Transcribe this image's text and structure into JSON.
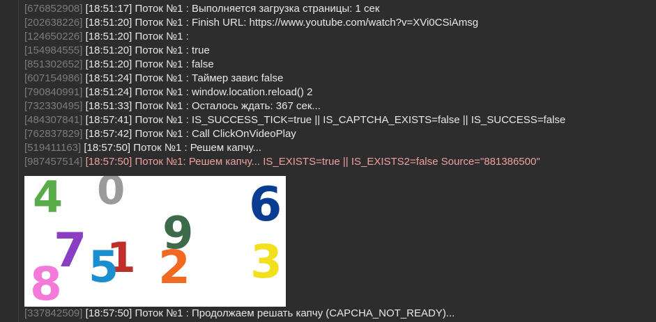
{
  "log": {
    "lines_top": [
      {
        "id": "[676852908]",
        "time": "[18:51:17]",
        "text": "Поток №1 : Выполняется загрузка страницы: 1 сек"
      },
      {
        "id": "[202638226]",
        "time": "[18:51:20]",
        "text": "Поток №1 : Finish URL: https://www.youtube.com/watch?v=XVi0CSiAmsg"
      },
      {
        "id": "[124650226]",
        "time": "[18:51:20]",
        "text": "Поток №1 :"
      },
      {
        "id": "[154984555]",
        "time": "[18:51:20]",
        "text": "Поток №1 : true"
      },
      {
        "id": "[851302652]",
        "time": "[18:51:20]",
        "text": "Поток №1 : false"
      },
      {
        "id": "[607154986]",
        "time": "[18:51:24]",
        "text": "Поток №1 : Таймер завис false"
      },
      {
        "id": "[790840991]",
        "time": "[18:51:24]",
        "text": "Поток №1 : window.location.reload() 2"
      },
      {
        "id": "[732330495]",
        "time": "[18:51:33]",
        "text": "Поток №1 : Осталось ждать: 367 сек..."
      },
      {
        "id": "[484307841]",
        "time": "[18:57:41]",
        "text": "Поток №1 : IS_SUCCESS_TICK=true || IS_CAPTCHA_EXISTS=false || IS_SUCCESS=false"
      },
      {
        "id": "[762837829]",
        "time": "[18:57:42]",
        "text": "Поток №1 : Call ClickOnVideoPlay"
      },
      {
        "id": "[519411163]",
        "time": "[18:57:50]",
        "text": "Поток №1 : Решем капчу..."
      },
      {
        "id": "[987457514]",
        "time": "[18:57:50]",
        "text": "Поток №1: Решем капчу... IS_EXISTS=true || IS_EXISTS2=false Source=\"881386500\"",
        "highlight": true
      }
    ],
    "line_bottom": {
      "id": "[337842509]",
      "time": "[18:57:50]",
      "text": "Поток №1 : Продолжаем решать капчу (CAPCHA_NOT_READY)..."
    }
  },
  "captcha": {
    "digits": [
      {
        "char": "4",
        "color": "#5aab4a"
      },
      {
        "char": "0",
        "color": "#9a9a9a"
      },
      {
        "char": "6",
        "color": "#0a3d91"
      },
      {
        "char": "9",
        "color": "#3d6a4a"
      },
      {
        "char": "7",
        "color": "#8a3fc2"
      },
      {
        "char": "5",
        "color": "#1a8fd0"
      },
      {
        "char": "1",
        "color": "#c0302a"
      },
      {
        "char": "2",
        "color": "#f26a21"
      },
      {
        "char": "3",
        "color": "#f2e01e"
      },
      {
        "char": "8",
        "color": "#f47ad9"
      }
    ]
  },
  "colors": {
    "background": "#2d2d2d",
    "text": "#e8e8e8",
    "id_text": "#7c7c7c",
    "highlight_text": "#f0a0a0"
  }
}
